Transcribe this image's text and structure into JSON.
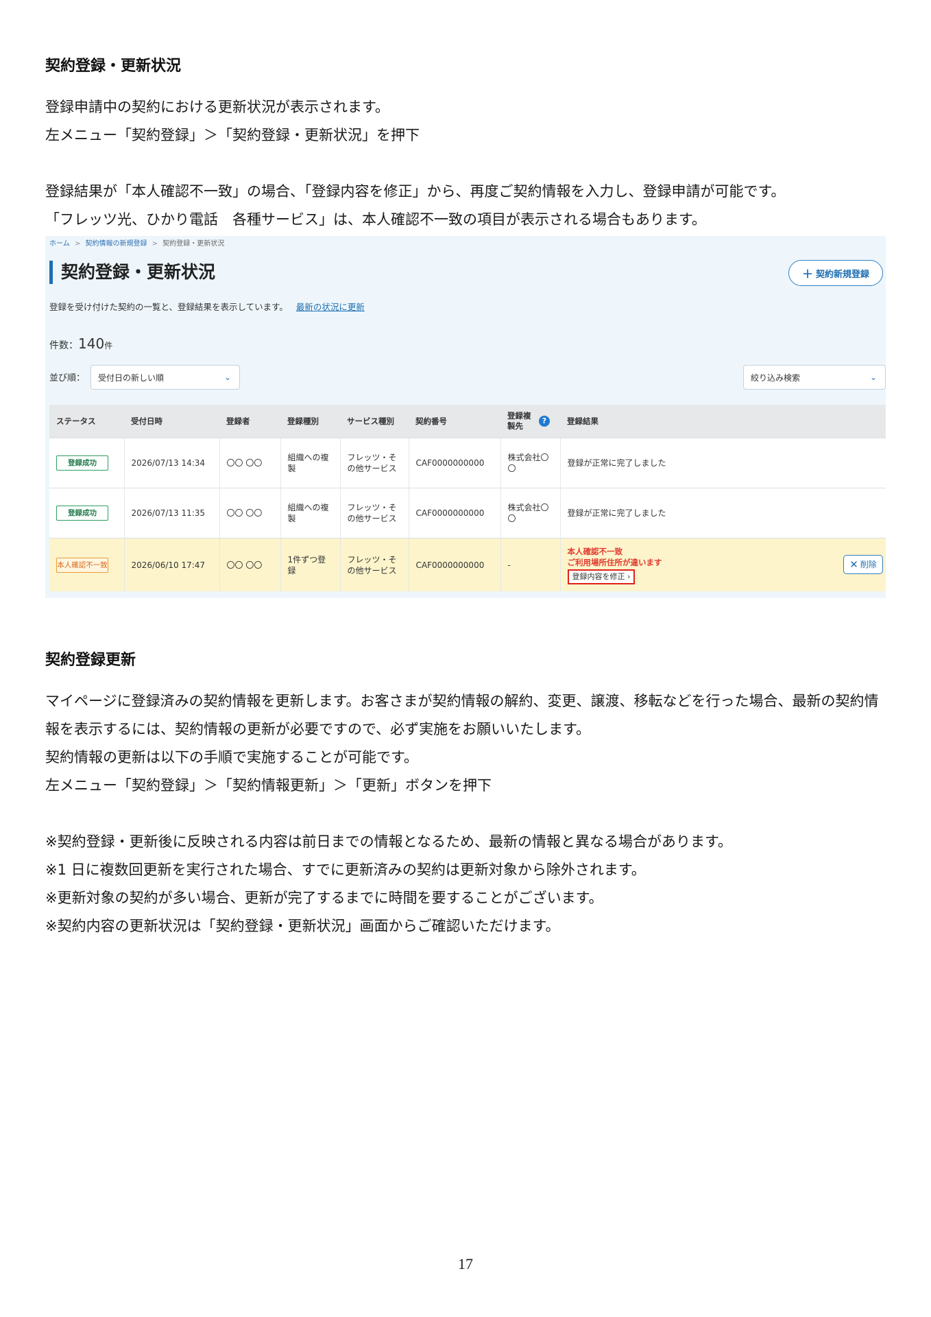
{
  "section1": {
    "heading": "契約登録・更新状況",
    "lines": [
      "登録申請中の契約における更新状況が表示されます。",
      "左メニュー「契約登録」＞「契約登録・更新状況」を押下",
      "",
      "登録結果が「本人確認不一致」の場合、「登録内容を修正」から、再度ご契約情報を入力し、登録申請が可能です。",
      "「フレッツ光、ひかり電話　各種サービス」は、本人確認不一致の項目が表示される場合もあります。"
    ]
  },
  "screen": {
    "breadcrumb": [
      "ホーム",
      "契約情報の新規登録",
      "契約登録・更新状況"
    ],
    "breadcrumb_sep": ">",
    "title": "契約登録・更新状況",
    "new_button": "契約新規登録",
    "description": "登録を受け付けた契約の一覧と、登録結果を表示しています。",
    "refresh_link": "最新の状況に更新",
    "count_label": "件数：",
    "count_value": "140",
    "count_unit": "件",
    "sort_label": "並び順：",
    "sort_value": "受付日の新しい順",
    "filter_value": "絞り込み検索",
    "columns": [
      "ステータス",
      "受付日時",
      "登録者",
      "登録種別",
      "サービス種別",
      "契約番号",
      "登録複製先",
      "登録結果"
    ],
    "rows": [
      {
        "status": "登録成功",
        "date": "2026/07/13 14:34",
        "registrant": "〇〇 〇〇",
        "type": "組織への複製",
        "service": "フレッツ・その他サービス",
        "contract": "CAF0000000000",
        "dest": "株式会社〇〇",
        "result": "登録が正常に完了しました"
      },
      {
        "status": "登録成功",
        "date": "2026/07/13 11:35",
        "registrant": "〇〇 〇〇",
        "type": "組織への複製",
        "service": "フレッツ・その他サービス",
        "contract": "CAF0000000000",
        "dest": "株式会社〇〇",
        "result": "登録が正常に完了しました"
      },
      {
        "status": "本人確認不一致",
        "date": "2026/06/10 17:47",
        "registrant": "〇〇 〇〇",
        "type": "1件ずつ登録",
        "service": "フレッツ・その他サービス",
        "contract": "CAF0000000000",
        "dest": "-",
        "result_err1": "本人確認不一致",
        "result_err2": "ご利用場所住所が違います",
        "fix_button": "登録内容を修正",
        "delete_button": "削除"
      }
    ]
  },
  "section2": {
    "heading": "契約登録更新",
    "lines": [
      "マイページに登録済みの契約情報を更新します。お客さまが契約情報の解約、変更、譲渡、移転などを行った場合、最新の契約情",
      "報を表示するには、契約情報の更新が必要ですので、必ず実施をお願いいたします。",
      "契約情報の更新は以下の手順で実施することが可能です。",
      "左メニュー「契約登録」＞「契約情報更新」＞「更新」ボタンを押下",
      "",
      "※契約登録・更新後に反映される内容は前日までの情報となるため、最新の情報と異なる場合があります。",
      "※1 日に複数回更新を実行された場合、すでに更新済みの契約は更新対象から除外されます。",
      "※更新対象の契約が多い場合、更新が完了するまでに時間を要することがございます。",
      "※契約内容の更新状況は「契約登録・更新状況」画面からご確認いただけます。"
    ]
  },
  "page_number": "17"
}
